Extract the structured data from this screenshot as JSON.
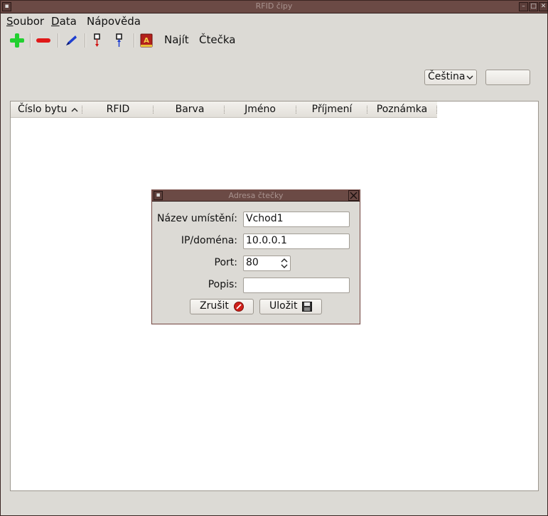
{
  "window": {
    "title": "RFID čipy"
  },
  "menu": {
    "soubor_first": "S",
    "soubor_rest": "oubor",
    "data_first": "D",
    "data_rest": "ata",
    "napoveda": "Nápověda"
  },
  "toolbar": {
    "add_icon": "plus-icon",
    "remove_icon": "minus-icon",
    "edit_icon": "pencil-icon",
    "find_label": "Najít",
    "reader_label": "Čtečka"
  },
  "language": {
    "selected": "Čeština"
  },
  "table": {
    "columns": [
      "Číslo bytu",
      "RFID",
      "Barva",
      "Jméno",
      "Příjmení",
      "Poznámka"
    ],
    "rows": []
  },
  "dialog": {
    "title": "Adresa čtečky",
    "name_label": "Název umístění:",
    "name_value": "Vchod1",
    "ip_label": "IP/doména:",
    "ip_value": "10.0.0.1",
    "port_label": "Port:",
    "port_value": "80",
    "desc_label": "Popis:",
    "desc_value": "",
    "cancel_label": "Zrušit",
    "save_label": "Uložit"
  },
  "colors": {
    "titlebar": "#6b4a45",
    "add": "#22d030",
    "remove": "#e01818",
    "edit": "#1f3fd0"
  }
}
